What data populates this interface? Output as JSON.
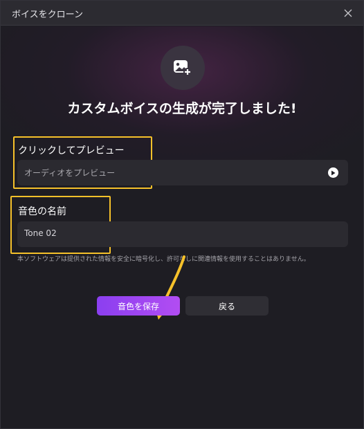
{
  "window": {
    "title": "ボイスをクローン"
  },
  "headline": "カスタムボイスの生成が完了しました!",
  "preview": {
    "label": "クリックしてプレビュー",
    "placeholder": "オーディオをプレビュー"
  },
  "voice_name": {
    "label": "音色の名前",
    "value": "Tone 02"
  },
  "disclaimer": "本ソフトウェアは提供された情報を安全に暗号化し、許可なしに関連情報を使用することはありません。",
  "buttons": {
    "save_label": "音色を保存",
    "back_label": "戻る"
  },
  "colors": {
    "highlight": "#f6c12a",
    "accent": "#8b3ff0"
  }
}
